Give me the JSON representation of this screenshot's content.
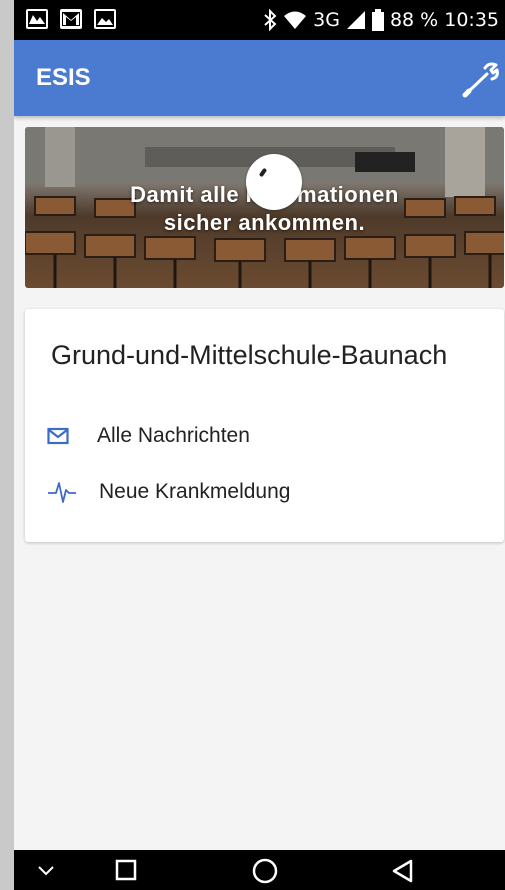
{
  "status_bar": {
    "network": "3G",
    "battery": "88 %",
    "time": "10:35"
  },
  "app_bar": {
    "title": "ESIS",
    "settings_icon": "wrench-icon"
  },
  "banner": {
    "line1": "Damit alle Informationen",
    "line2": "sicher ankommen."
  },
  "school": {
    "name": "Grund-und-Mittelschule-Baunach",
    "actions": [
      {
        "icon": "mail-icon",
        "label": "Alle Nachrichten"
      },
      {
        "icon": "heartbeat-icon",
        "label": "Neue Krankmeldung"
      }
    ]
  },
  "nav_bar": {
    "icons": [
      "chevron-down-icon",
      "recents-icon",
      "home-icon",
      "back-icon"
    ]
  },
  "colors": {
    "app_bar": "#4a7bd1",
    "icon_blue": "#3a6cc8"
  }
}
